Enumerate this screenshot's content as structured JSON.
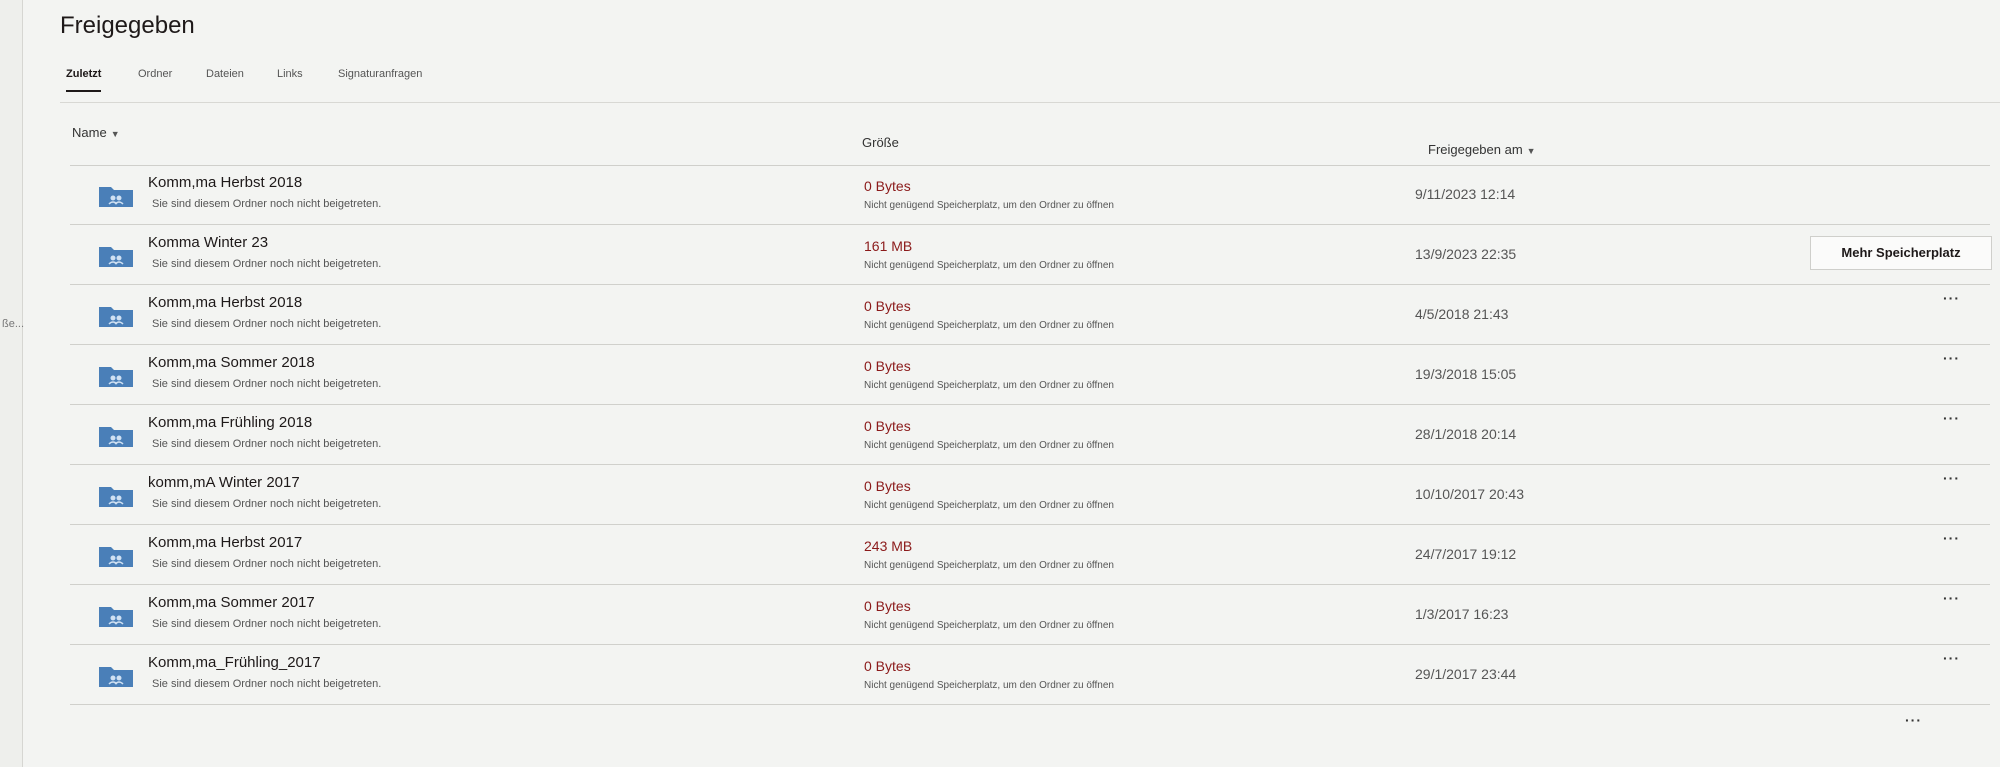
{
  "side": {
    "label": "ße..."
  },
  "page": {
    "title": "Freigegeben"
  },
  "tabs": [
    {
      "label": "Zuletzt",
      "active": true
    },
    {
      "label": "Ordner"
    },
    {
      "label": "Dateien"
    },
    {
      "label": "Links"
    },
    {
      "label": "Signaturanfragen"
    }
  ],
  "columns": {
    "name": "Name",
    "size": "Größe",
    "shared": "Freigegeben am"
  },
  "rows": [
    {
      "name": "Komm,ma Herbst 2018",
      "status": "Sie sind diesem Ordner noch nicht beigetreten.",
      "size": "0 Bytes",
      "size_note": "Nicht genügend Speicherplatz, um den Ordner zu öffnen",
      "date": "9/11/2023 12:14"
    },
    {
      "name": "Komma Winter 23",
      "status": "Sie sind diesem Ordner noch nicht beigetreten.",
      "size": "161 MB",
      "size_note": "Nicht genügend Speicherplatz, um den Ordner zu öffnen",
      "date": "13/9/2023 22:35"
    },
    {
      "name": "Komm,ma Herbst 2018",
      "status": "Sie sind diesem Ordner noch nicht beigetreten.",
      "size": "0 Bytes",
      "size_note": "Nicht genügend Speicherplatz, um den Ordner zu öffnen",
      "date": "4/5/2018 21:43"
    },
    {
      "name": "Komm,ma Sommer 2018",
      "status": "Sie sind diesem Ordner noch nicht beigetreten.",
      "size": "0 Bytes",
      "size_note": "Nicht genügend Speicherplatz, um den Ordner zu öffnen",
      "date": "19/3/2018 15:05"
    },
    {
      "name": "Komm,ma Frühling 2018",
      "status": "Sie sind diesem Ordner noch nicht beigetreten.",
      "size": "0 Bytes",
      "size_note": "Nicht genügend Speicherplatz, um den Ordner zu öffnen",
      "date": "28/1/2018 20:14"
    },
    {
      "name": "komm,mA Winter 2017",
      "status": "Sie sind diesem Ordner noch nicht beigetreten.",
      "size": "0 Bytes",
      "size_note": "Nicht genügend Speicherplatz, um den Ordner zu öffnen",
      "date": "10/10/2017 20:43"
    },
    {
      "name": "Komm,ma Herbst 2017",
      "status": "Sie sind diesem Ordner noch nicht beigetreten.",
      "size": "243 MB",
      "size_note": "Nicht genügend Speicherplatz, um den Ordner zu öffnen",
      "date": "24/7/2017 19:12"
    },
    {
      "name": "Komm,ma Sommer 2017",
      "status": "Sie sind diesem Ordner noch nicht beigetreten.",
      "size": "0 Bytes",
      "size_note": "Nicht genügend Speicherplatz, um den Ordner zu öffnen",
      "date": "1/3/2017 16:23"
    },
    {
      "name": "Komm,ma_Frühling_2017",
      "status": "Sie sind diesem Ordner noch nicht beigetreten.",
      "size": "0 Bytes",
      "size_note": "Nicht genügend Speicherplatz, um den Ordner zu öffnen",
      "date": "29/1/2017 23:44"
    }
  ],
  "row_action": {
    "label": "Mehr Speicherplatz"
  },
  "more_label": "···",
  "colors": {
    "folder": "#4a7fb8",
    "size_text": "#8b1a1a",
    "background": "#f3f4f2"
  },
  "icons": {
    "folder": "shared-folder-icon",
    "more": "ellipsis-icon",
    "sort": "caret-down-icon"
  }
}
